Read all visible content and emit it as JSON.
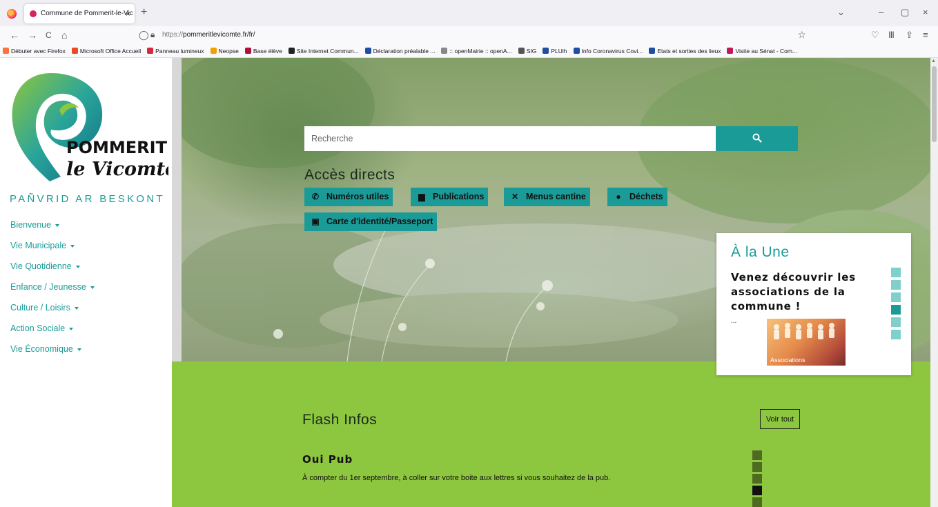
{
  "browser": {
    "tab_title": "Commune de Pommerit-le-Vic",
    "tab_close": "×",
    "new_tab": "+",
    "url_scheme": "https://",
    "url_host": "pommeritlevicomte.fr/fr/",
    "window_controls": {
      "list": "⌄",
      "minimize": "–",
      "restore": "▢",
      "close": "×"
    },
    "nav": {
      "back": "←",
      "forward": "→",
      "reload": "C",
      "home": "⌂"
    }
  },
  "bookmarks": [
    {
      "label": "Débuter avec Firefox",
      "color": "#ff7139"
    },
    {
      "label": "Microsoft Office Accueil",
      "color": "#e84b25"
    },
    {
      "label": "Panneau lumineux",
      "color": "#d7263d"
    },
    {
      "label": "Neopse",
      "color": "#f2a100"
    },
    {
      "label": "Base élève",
      "color": "#b0103a"
    },
    {
      "label": "Site Internet Commun...",
      "color": "#222222"
    },
    {
      "label": "Déclaration préalable ...",
      "color": "#1f4ea3"
    },
    {
      "label": ":: openMairie :: openA...",
      "color": "#888888"
    },
    {
      "label": "SIG",
      "color": "#555555"
    },
    {
      "label": "PLUih",
      "color": "#1f4ea3"
    },
    {
      "label": "Info Coronavirus Covi...",
      "color": "#1f4ea3"
    },
    {
      "label": "Etats et sorties des lieux",
      "color": "#1f4ea3"
    },
    {
      "label": "Visite au Sénat - Com...",
      "color": "#c2185b"
    }
  ],
  "site": {
    "logo_line1": "POMMERIT",
    "logo_line2": "le Vicomte",
    "tagline": "PAÑVRID AR BESKONT",
    "accent": "#1a9b97",
    "menu": [
      "Bienvenue",
      "Vie Municipale",
      "Vie Quotidienne",
      "Enfance / Jeunesse",
      "Culture / Loisirs",
      "Action Sociale",
      "Vie Économique"
    ]
  },
  "search": {
    "placeholder": "Recherche",
    "button_icon": "search-icon"
  },
  "acces": {
    "title": "Accès directs",
    "links": [
      {
        "label": "Numéros utiles",
        "icon": "phone-icon"
      },
      {
        "label": "Publications",
        "icon": "book-icon"
      },
      {
        "label": "Menus cantine",
        "icon": "utensils-icon"
      },
      {
        "label": "Déchets",
        "icon": "globe-icon"
      },
      {
        "label": "Carte d'identité/Passeport",
        "icon": "calendar-icon"
      }
    ]
  },
  "une": {
    "title": "À la Une",
    "heading": "Venez découvrir les associations de la commune !",
    "ellipsis": "...",
    "image_label": "Associations",
    "slides_total": 6,
    "slide_active": 4
  },
  "flash": {
    "title": "Flash Infos",
    "voir_tout": "Voir tout",
    "item_title": "Oui Pub",
    "item_text": "À compter du 1er septembre, à coller sur votre boite aux lettres si vous souhaitez de la pub.",
    "green": "#8dc63f",
    "slides_total": 5,
    "slide_active": 4
  }
}
